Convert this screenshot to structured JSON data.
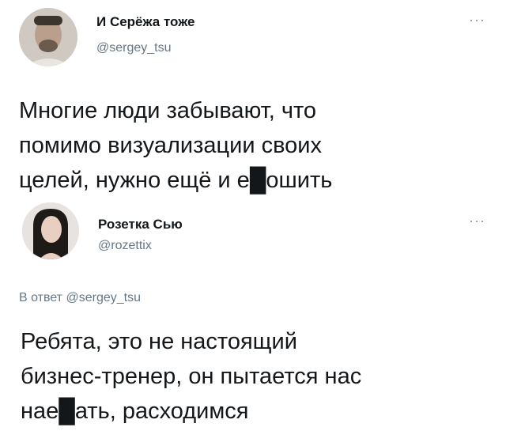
{
  "tweets": [
    {
      "author_name": "И Серёжа тоже",
      "handle": "@sergey_tsu",
      "more_icon": "more-icon",
      "lines": [
        "Многие люди забывают, что",
        "помимо визуализации своих",
        "целей, нужно ещё и е█ошить"
      ]
    },
    {
      "author_name": "Розетка Сью",
      "handle": "@rozettix",
      "more_icon": "more-icon",
      "reply_prefix": "В ответ",
      "reply_mention": "@sergey_tsu",
      "lines": [
        "Ребята, это не настоящий",
        "бизнес-тренер, он пытается нас",
        "нае█ать, расходимся"
      ]
    }
  ],
  "colors": {
    "text": "#14171a",
    "secondary": "#657786",
    "more": "#8899a6"
  }
}
